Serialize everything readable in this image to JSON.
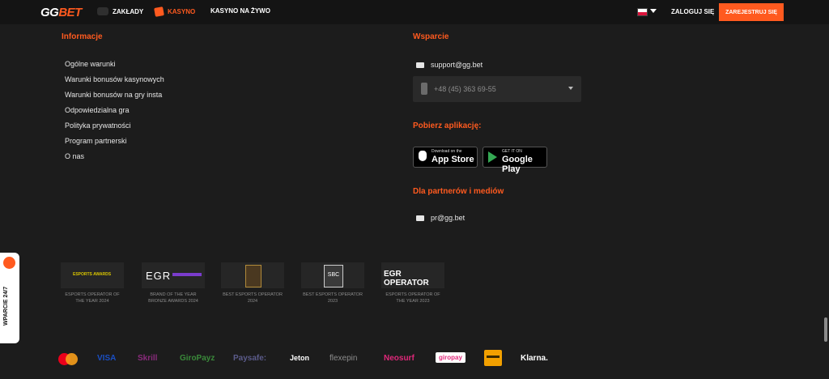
{
  "header": {
    "logo_a": "GG",
    "logo_b": "BET",
    "nav": [
      {
        "label": "ZAKŁADY",
        "icon": "ticket-icon"
      },
      {
        "label": "KASYNO",
        "icon": "dice-icon"
      },
      {
        "label": "KASYNO NA ŻYWO"
      }
    ],
    "language": "PL",
    "login_label": "ZALOGUJ SIĘ",
    "register_label": "ZAREJESTRUJ SIĘ"
  },
  "info": {
    "heading": "Informacje",
    "links": [
      "Ogólne warunki",
      "Warunki bonusów kasynowych",
      "Warunki bonusów na gry insta",
      "Odpowiedzialna gra",
      "Polityka prywatności",
      "Program partnerski",
      "O nas"
    ]
  },
  "support": {
    "heading": "Wsparcie",
    "email": "support@gg.bet",
    "phone": "+48 (45) 363 69-55"
  },
  "apps": {
    "heading": "Pobierz aplikację:",
    "appstore_small": "Download on the",
    "appstore_big": "App Store",
    "googleplay_small": "GET IT ON",
    "googleplay_big": "Google Play"
  },
  "partners": {
    "heading": "Dla partnerów i mediów",
    "email": "pr@gg.bet"
  },
  "awards": [
    {
      "badge": "ESPORTS AWARDS",
      "caption": "ESPORTS OPERATOR OF THE YEAR 2024"
    },
    {
      "badge": "EGR",
      "caption": "BRAND OF THE YEAR BRONZE AWARDS 2024"
    },
    {
      "badge": "",
      "caption": "BEST ESPORTS OPERATOR 2024"
    },
    {
      "badge": "SBC",
      "caption": "BEST ESPORTS OPERATOR 2023"
    },
    {
      "badge": "EGR OPERATOR",
      "caption": "ESPORTS OPERATOR OF THE YEAR 2023"
    }
  ],
  "payments": [
    {
      "label": "VISA",
      "color": "#1a4fc4"
    },
    {
      "label": "Skrill",
      "color": "#8a2b7c"
    },
    {
      "label": "GiroPayz",
      "color": "#3a8a3a"
    },
    {
      "label": "Paysafe:",
      "color": "#5b5b8a"
    },
    {
      "label": "Jeton",
      "color": "#ffffff"
    },
    {
      "label": "flexepin",
      "color": "#8c8c8c"
    },
    {
      "label": "Neosurf",
      "color": "#e0287a"
    },
    {
      "label": "giropay",
      "color": "#ffffff"
    },
    {
      "label": "Klarna.",
      "color": "#ffffff"
    }
  ],
  "side_widget": {
    "label": "WPARCIE 24/7"
  }
}
